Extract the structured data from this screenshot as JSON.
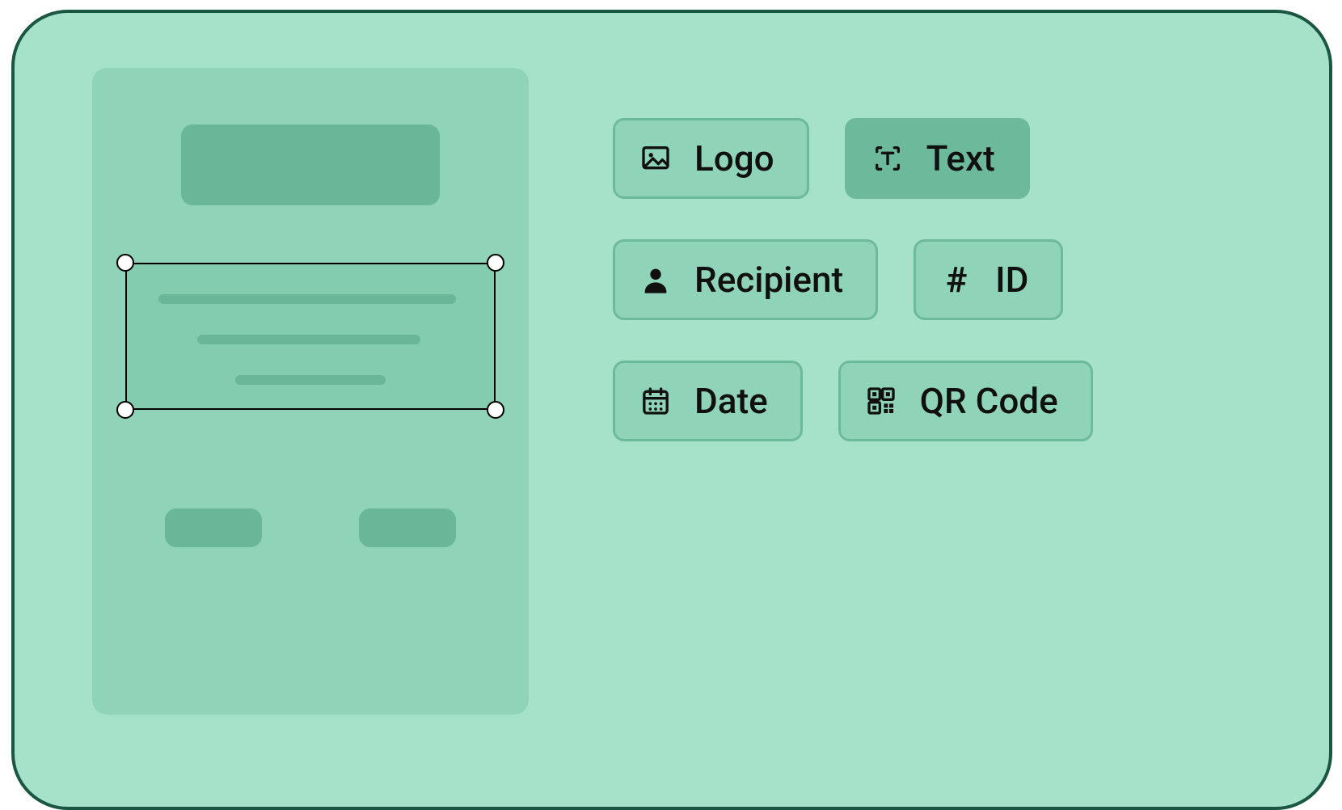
{
  "picker": {
    "logo": {
      "label": "Logo"
    },
    "text": {
      "label": "Text",
      "selected": true
    },
    "recipient": {
      "label": "Recipient"
    },
    "id": {
      "label": "ID"
    },
    "date": {
      "label": "Date"
    },
    "qr": {
      "label": "QR Code"
    }
  }
}
